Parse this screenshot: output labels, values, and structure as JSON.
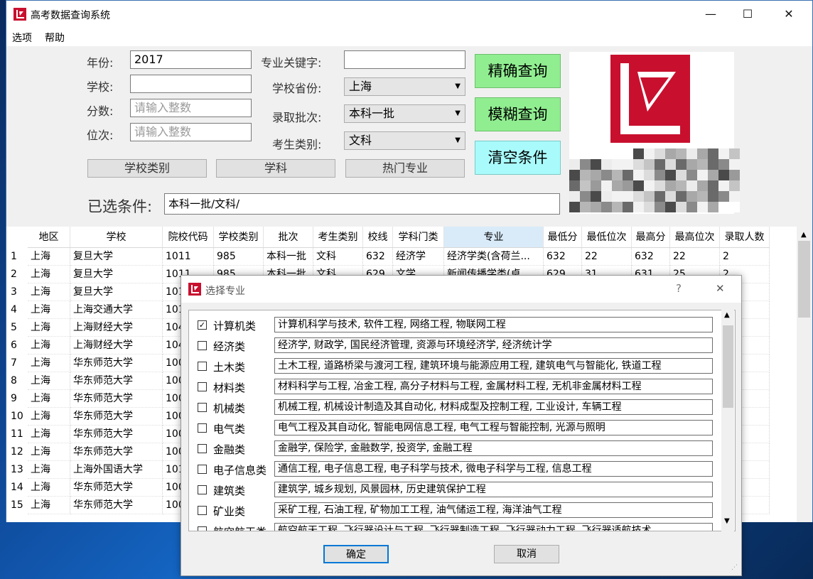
{
  "window": {
    "title": "高考数据查询系统",
    "min": "—",
    "max": "☐",
    "close": "✕"
  },
  "menu": {
    "options": "选项",
    "help": "帮助"
  },
  "form": {
    "year_label": "年份:",
    "year_value": "2017",
    "school_label": "学校:",
    "school_value": "",
    "score_label": "分数:",
    "score_placeholder": "请输入整数",
    "rank_label": "位次:",
    "rank_placeholder": "请输入整数",
    "keyword_label": "专业关键字:",
    "keyword_value": "",
    "province_label": "学校省份:",
    "province_value": "上海",
    "batch_label": "录取批次:",
    "batch_value": "本科一批",
    "type_label": "考生类别:",
    "type_value": "文科",
    "exact_btn": "精确查询",
    "fuzzy_btn": "模糊查询",
    "clear_btn": "清空条件",
    "tab_school_type": "学校类别",
    "tab_subject": "学科",
    "tab_hot_major": "热门专业",
    "selected_label": "已选条件:",
    "selected_value": "本科一批/文科/"
  },
  "table": {
    "headers": [
      "地区",
      "学校",
      "院校代码",
      "学校类别",
      "批次",
      "考生类别",
      "校线",
      "学科门类",
      "专业",
      "最低分",
      "最低位次",
      "最高分",
      "最高位次",
      "录取人数"
    ],
    "rows": [
      {
        "n": "1",
        "c": [
          "上海",
          "复旦大学",
          "1011",
          "985",
          "本科一批",
          "文科",
          "632",
          "经济学",
          "经济学类(含荷兰...",
          "632",
          "22",
          "632",
          "22",
          "2"
        ]
      },
      {
        "n": "2",
        "c": [
          "上海",
          "复旦大学",
          "1011",
          "985",
          "本科一批",
          "文科",
          "629",
          "文学",
          "新闻传播学类(卓...",
          "629",
          "31",
          "631",
          "25",
          "2"
        ]
      },
      {
        "n": "3",
        "c": [
          "上海",
          "复旦大学",
          "101",
          "",
          "",
          "",
          "",
          "",
          "",
          "",
          "",
          "",
          "",
          ""
        ]
      },
      {
        "n": "4",
        "c": [
          "上海",
          "上海交通大学",
          "101",
          "",
          "",
          "",
          "",
          "",
          "",
          "",
          "",
          "",
          "",
          ""
        ]
      },
      {
        "n": "5",
        "c": [
          "上海",
          "上海财经大学",
          "104",
          "",
          "",
          "",
          "",
          "",
          "",
          "",
          "",
          "",
          "",
          ""
        ]
      },
      {
        "n": "6",
        "c": [
          "上海",
          "上海财经大学",
          "104",
          "",
          "",
          "",
          "",
          "",
          "",
          "",
          "",
          "",
          "",
          ""
        ]
      },
      {
        "n": "7",
        "c": [
          "上海",
          "华东师范大学",
          "100",
          "",
          "",
          "",
          "",
          "",
          "",
          "",
          "",
          "",
          "",
          ""
        ]
      },
      {
        "n": "8",
        "c": [
          "上海",
          "华东师范大学",
          "100",
          "",
          "",
          "",
          "",
          "",
          "",
          "",
          "",
          "",
          "",
          ""
        ]
      },
      {
        "n": "9",
        "c": [
          "上海",
          "华东师范大学",
          "100",
          "",
          "",
          "",
          "",
          "",
          "",
          "",
          "",
          "",
          "",
          ""
        ]
      },
      {
        "n": "10",
        "c": [
          "上海",
          "华东师范大学",
          "100",
          "",
          "",
          "",
          "",
          "",
          "",
          "",
          "",
          "",
          "",
          ""
        ]
      },
      {
        "n": "11",
        "c": [
          "上海",
          "华东师范大学",
          "100",
          "",
          "",
          "",
          "",
          "",
          "",
          "",
          "",
          "",
          "",
          ""
        ]
      },
      {
        "n": "12",
        "c": [
          "上海",
          "华东师范大学",
          "100",
          "",
          "",
          "",
          "",
          "",
          "",
          "",
          "",
          "",
          "",
          ""
        ]
      },
      {
        "n": "13",
        "c": [
          "上海",
          "上海外国语大学",
          "101",
          "",
          "",
          "",
          "",
          "",
          "",
          "",
          "",
          "",
          "",
          ""
        ]
      },
      {
        "n": "14",
        "c": [
          "上海",
          "华东师范大学",
          "100",
          "",
          "",
          "",
          "",
          "",
          "",
          "",
          "",
          "",
          "",
          ""
        ]
      },
      {
        "n": "15",
        "c": [
          "上海",
          "华东师范大学",
          "100",
          "",
          "",
          "",
          "",
          "",
          "",
          "",
          "",
          "",
          "",
          ""
        ]
      }
    ]
  },
  "dialog": {
    "title": "选择专业",
    "help": "?",
    "close": "✕",
    "items": [
      {
        "checked": true,
        "cat": "计算机类",
        "desc": "计算机科学与技术, 软件工程, 网络工程, 物联网工程"
      },
      {
        "checked": false,
        "cat": "经济类",
        "desc": "经济学, 财政学, 国民经济管理, 资源与环境经济学, 经济统计学"
      },
      {
        "checked": false,
        "cat": "土木类",
        "desc": "土木工程, 道路桥梁与渡河工程, 建筑环境与能源应用工程, 建筑电气与智能化, 铁道工程"
      },
      {
        "checked": false,
        "cat": "材料类",
        "desc": "材料科学与工程, 冶金工程, 高分子材料与工程, 金属材料工程, 无机非金属材料工程"
      },
      {
        "checked": false,
        "cat": "机械类",
        "desc": "机械工程, 机械设计制造及其自动化, 材料成型及控制工程, 工业设计, 车辆工程"
      },
      {
        "checked": false,
        "cat": "电气类",
        "desc": "电气工程及其自动化, 智能电网信息工程, 电气工程与智能控制, 光源与照明"
      },
      {
        "checked": false,
        "cat": "金融类",
        "desc": "金融学, 保险学, 金融数学, 投资学, 金融工程"
      },
      {
        "checked": false,
        "cat": "电子信息类",
        "desc": "通信工程, 电子信息工程, 电子科学与技术, 微电子科学与工程, 信息工程"
      },
      {
        "checked": false,
        "cat": "建筑类",
        "desc": "建筑学, 城乡规划, 风景园林, 历史建筑保护工程"
      },
      {
        "checked": false,
        "cat": "矿业类",
        "desc": "采矿工程, 石油工程, 矿物加工工程, 油气储运工程, 海洋油气工程"
      },
      {
        "checked": false,
        "cat": "航空航天类",
        "desc": "航空航天工程, 飞行器设计与工程, 飞行器制造工程, 飞行器动力工程, 飞行器适航技术"
      }
    ],
    "ok": "确定",
    "cancel": "取消"
  },
  "colors": {
    "logo_red": "#c8102e",
    "green_btn": "#90ee90",
    "cyan_btn": "#a9fbfb"
  }
}
